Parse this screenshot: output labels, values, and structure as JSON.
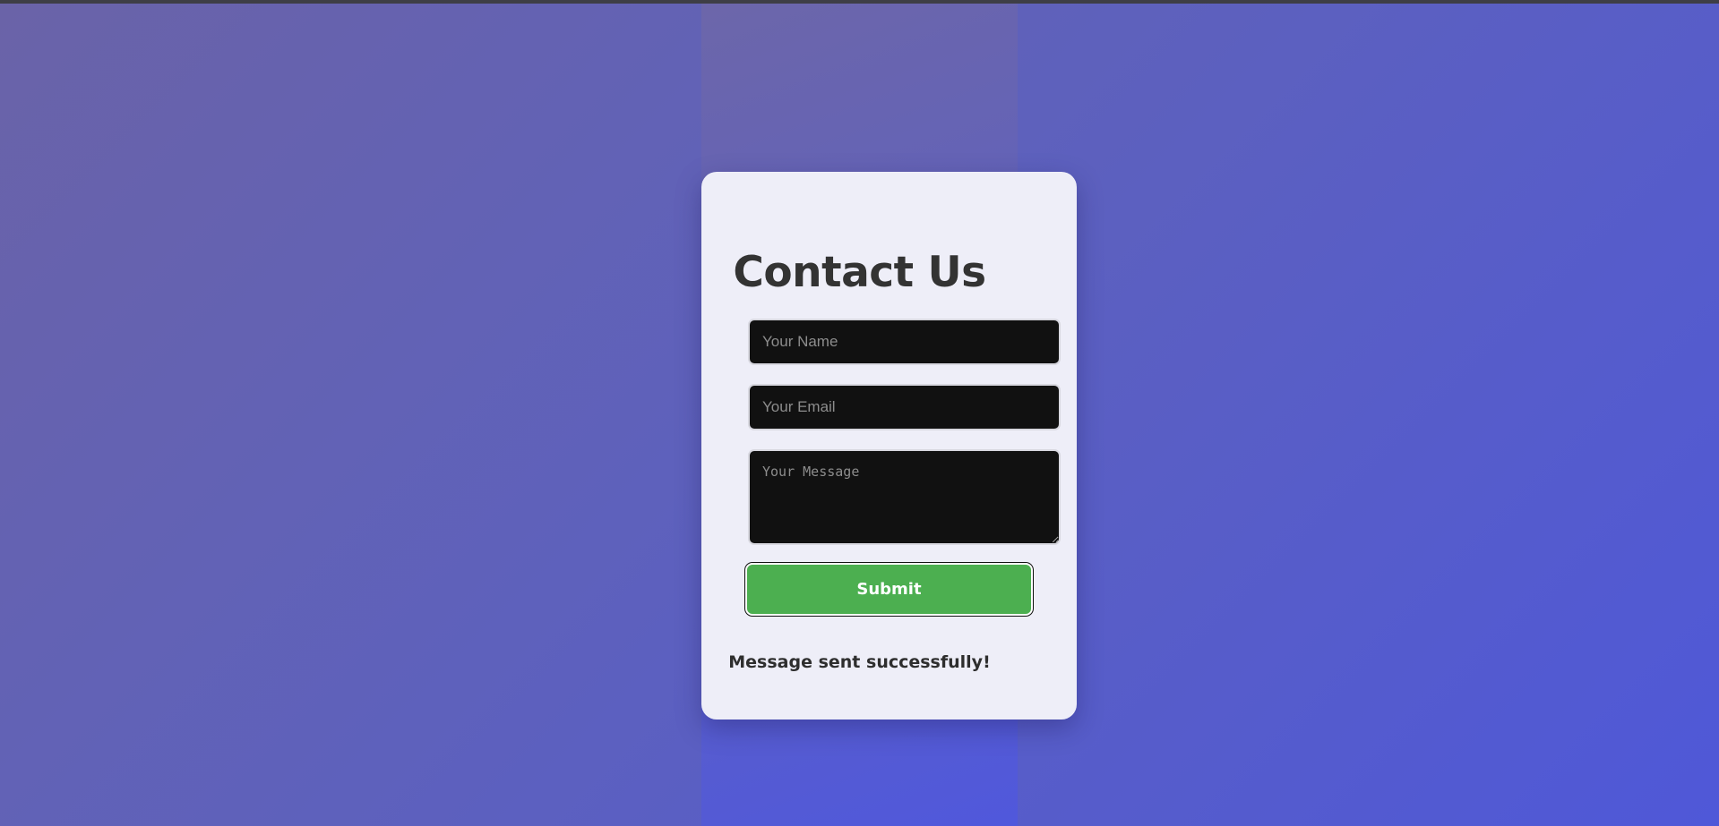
{
  "form": {
    "title": "Contact Us",
    "name_placeholder": "Your Name",
    "email_placeholder": "Your Email",
    "message_placeholder": "Your Message",
    "submit_label": "Submit",
    "status_message": "Message sent successfully!"
  },
  "colors": {
    "background_start": "#6a63a8",
    "background_end": "#4f58d8",
    "card_background": "#eeeef8",
    "field_background": "#111111",
    "submit_background": "#4caf50",
    "text_dark": "#333333"
  }
}
